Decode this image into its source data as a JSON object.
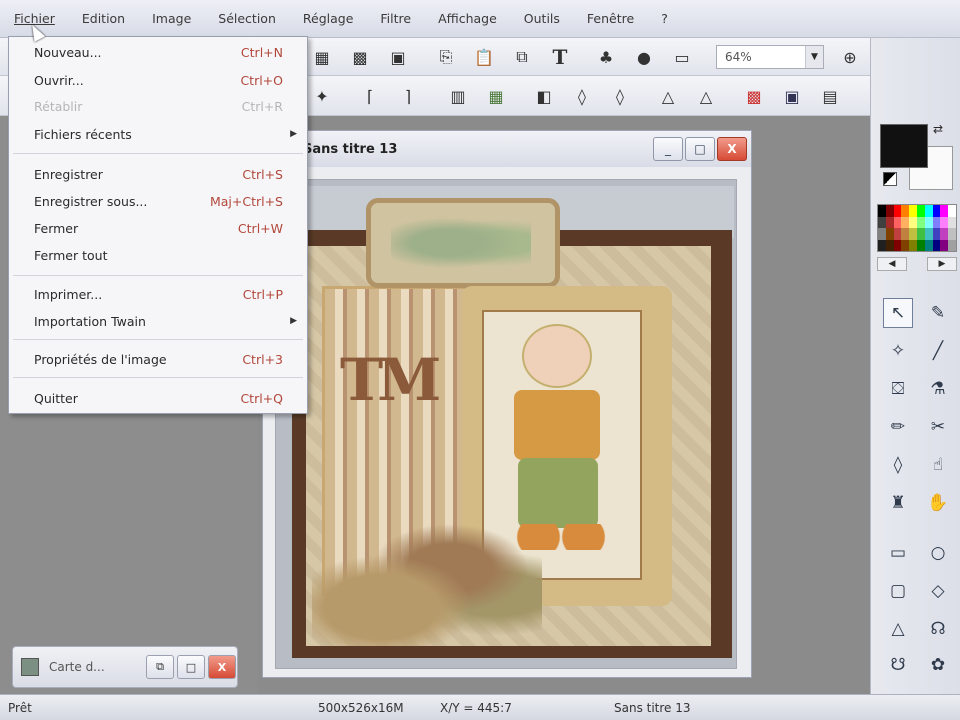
{
  "menubar": {
    "items": [
      "Fichier",
      "Edition",
      "Image",
      "Sélection",
      "Réglage",
      "Filtre",
      "Affichage",
      "Outils",
      "Fenêtre",
      "?"
    ]
  },
  "file_menu": {
    "items": [
      {
        "label": "Nouveau...",
        "shortcut": "Ctrl+N",
        "enabled": true
      },
      {
        "label": "Ouvrir...",
        "shortcut": "Ctrl+O",
        "enabled": true
      },
      {
        "label": "Rétablir",
        "shortcut": "Ctrl+R",
        "enabled": false
      },
      {
        "label": "Fichiers récents",
        "shortcut": "",
        "enabled": true,
        "submenu": true
      },
      {
        "label": "Enregistrer",
        "shortcut": "Ctrl+S",
        "enabled": true
      },
      {
        "label": "Enregistrer sous...",
        "shortcut": "Maj+Ctrl+S",
        "enabled": true
      },
      {
        "label": "Fermer",
        "shortcut": "Ctrl+W",
        "enabled": true
      },
      {
        "label": "Fermer tout",
        "shortcut": "",
        "enabled": true
      },
      {
        "label": "Imprimer...",
        "shortcut": "Ctrl+P",
        "enabled": true
      },
      {
        "label": "Importation Twain",
        "shortcut": "",
        "enabled": true,
        "submenu": true
      },
      {
        "label": "Propriétés de l'image",
        "shortcut": "Ctrl+3",
        "enabled": true
      },
      {
        "label": "Quitter",
        "shortcut": "Ctrl+Q",
        "enabled": true
      }
    ]
  },
  "toolbar": {
    "text_tool": "T",
    "zoom_value": "64%",
    "dropdown_arrow": "▼",
    "icons": [
      "new-icon",
      "open-icon",
      "save-icon",
      "copy-icon",
      "paste-icon",
      "text-tool-icon",
      "zoom-in-icon",
      "zoom-out-icon",
      "fit-icon"
    ]
  },
  "document": {
    "title": "Sans titre 13",
    "minimize": "_",
    "maximize": "□",
    "close": "X"
  },
  "minimized_window": {
    "title": "Carte d...",
    "restore": "⧉",
    "maximize": "□",
    "close": "X"
  },
  "status": {
    "state": "Prêt",
    "dimensions": "500x526x16M",
    "coords": "X/Y = 445:7",
    "doc": "Sans titre 13"
  },
  "colors": {
    "foreground": "#111111",
    "background": "#fafafa",
    "shortcut_text": "#b2473b",
    "close_button": "#d64b35"
  }
}
